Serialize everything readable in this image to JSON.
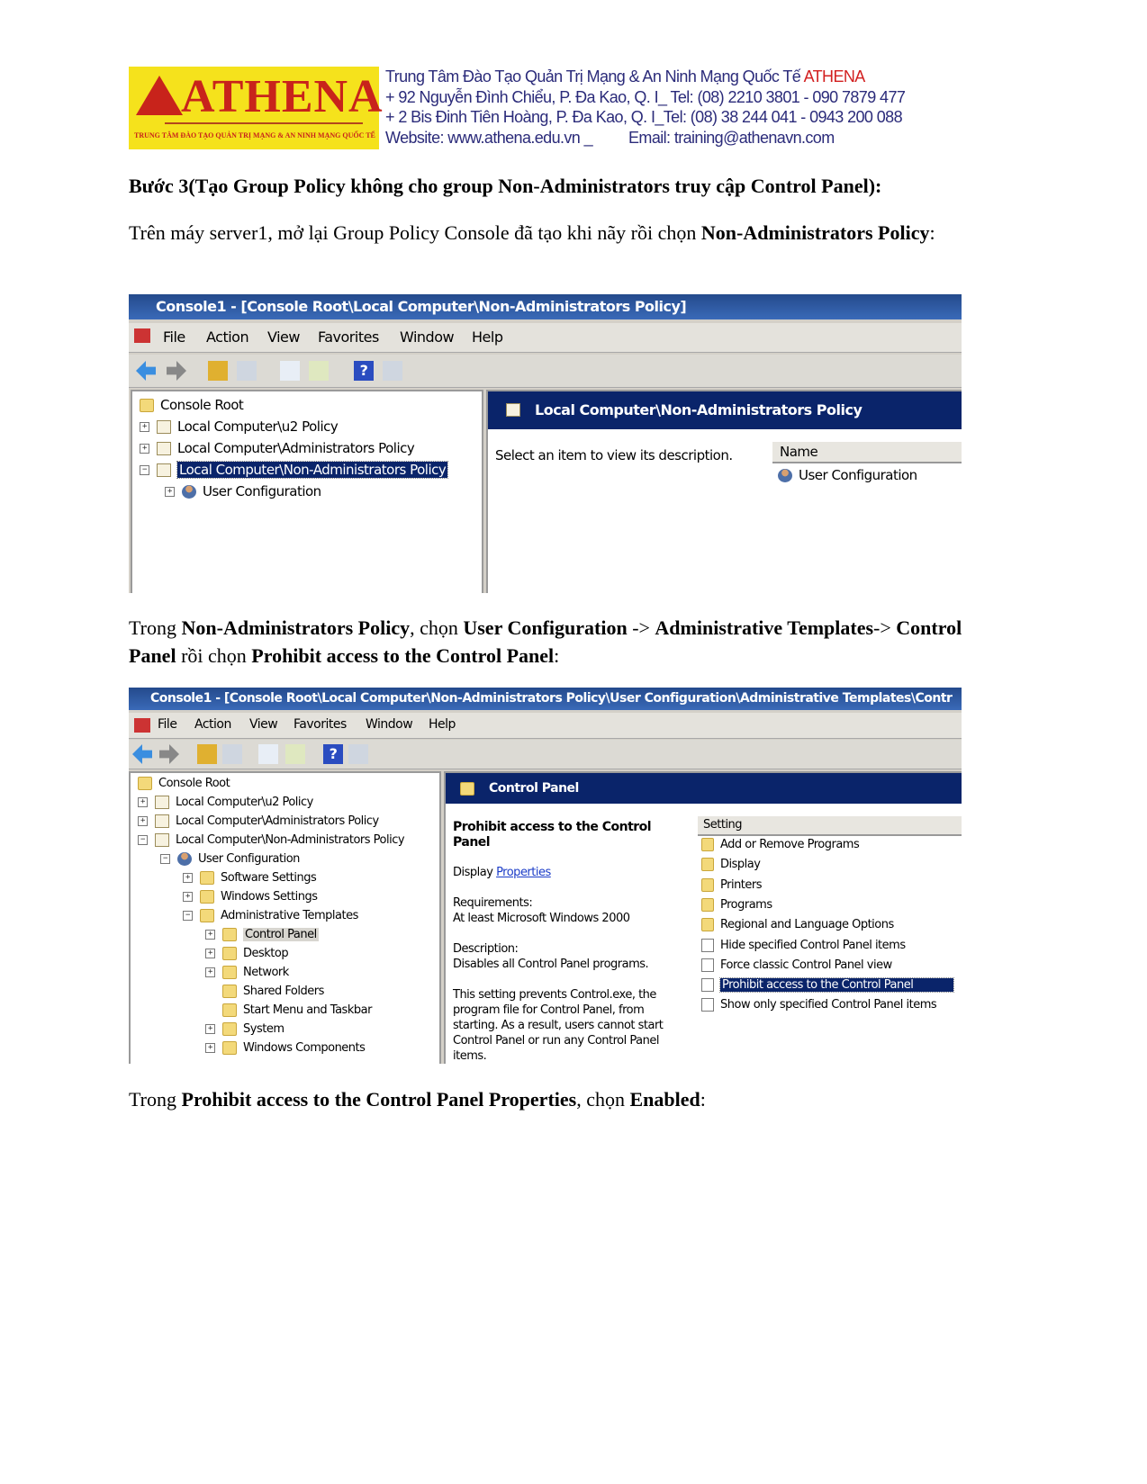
{
  "banner": {
    "logo_text": "ATHENA",
    "logo_subtitle": "TRUNG TÂM ĐÀO TẠO QUẢN TRỊ MẠNG & AN NINH MẠNG QUỐC TẾ",
    "line1": "Trung Tâm Đào Tạo Quản Trị Mạng & An Ninh Mạng Quốc Tế ",
    "brand": "ATHENA",
    "line2": "+ 92 Nguyễn Đình Chiểu, P. Đa Kao, Q. I_ Tel: (08) 2210 3801 -  090 7879 477",
    "line3": "+ 2 Bis Đinh Tiên Hoàng, P. Đa Kao, Q. I_Tel: (08) 38 244 041 - 0943 200 088",
    "website": "Website: www.athena.edu.vn   _",
    "email": "Email: training@athenavn.com",
    "colors": {
      "logo_bg": "#f5e21c",
      "logo_red": "#c8231b",
      "text_blue": "#2b2b7a"
    }
  },
  "step_heading": "Bước 3(Tạo Group Policy không cho group Non-Administrators truy cập Control Panel):",
  "para1": {
    "t1": "Trên máy server1, mở lại Group Policy Console đã tạo khi nãy rồi chọn ",
    "b1": "Non-Administrators Policy",
    "t2": ":"
  },
  "para2": {
    "t1": "Trong ",
    "b1": "Non-Administrators Policy",
    "t2": ", chọn ",
    "b2": "User Configuration",
    "t3": " -> ",
    "b3": "Administrative Templates",
    "t4": "-> ",
    "b4": "Control Panel",
    "t5": " rồi chọn ",
    "b5": "Prohibit access to the Control Panel",
    "t6": ":"
  },
  "para3": {
    "t1": "Trong ",
    "b1": "Prohibit access to the Control Panel Properties",
    "t2": ", chọn ",
    "b2": "Enabled",
    "t3": ":"
  },
  "menu": [
    "File",
    "Action",
    "View",
    "Favorites",
    "Window",
    "Help"
  ],
  "toolbar_icons": [
    "back-arrow-icon",
    "forward-arrow-icon",
    "up-folder-icon",
    "show-hide-tree-icon",
    "properties-icon",
    "export-list-icon",
    "help-icon",
    "show-action-pane-icon"
  ],
  "screenshot1": {
    "title": "Console1 - [Console Root\\Local Computer\\Non-Administrators Policy]",
    "tree": [
      {
        "label": "Console Root",
        "icon": "folder",
        "expander": "",
        "level": 0
      },
      {
        "label": "Local Computer\\u2 Policy",
        "icon": "scroll",
        "expander": "+",
        "level": 0
      },
      {
        "label": "Local Computer\\Administrators Policy",
        "icon": "scroll",
        "expander": "+",
        "level": 0
      },
      {
        "label": "Local Computer\\Non-Administrators Policy",
        "icon": "scroll",
        "expander": "−",
        "level": 0,
        "selected": true
      },
      {
        "label": "User Configuration",
        "icon": "user",
        "expander": "+",
        "level": 1
      }
    ],
    "header": "Local Computer\\Non-Administrators Policy",
    "description": "Select an item to view its description.",
    "column": "Name",
    "items": [
      "User Configuration"
    ]
  },
  "screenshot2": {
    "title": "Console1 - [Console Root\\Local Computer\\Non-Administrators Policy\\User Configuration\\Administrative Templates\\Contr",
    "tree": [
      {
        "label": "Console Root",
        "icon": "folder",
        "expander": "",
        "level": 0
      },
      {
        "label": "Local Computer\\u2 Policy",
        "icon": "scroll",
        "expander": "+",
        "level": 0
      },
      {
        "label": "Local Computer\\Administrators Policy",
        "icon": "scroll",
        "expander": "+",
        "level": 0
      },
      {
        "label": "Local Computer\\Non-Administrators Policy",
        "icon": "scroll",
        "expander": "−",
        "level": 0
      },
      {
        "label": "User Configuration",
        "icon": "user",
        "expander": "−",
        "level": 1
      },
      {
        "label": "Software Settings",
        "icon": "folder",
        "expander": "+",
        "level": 2
      },
      {
        "label": "Windows Settings",
        "icon": "folder",
        "expander": "+",
        "level": 2
      },
      {
        "label": "Administrative Templates",
        "icon": "folder",
        "expander": "−",
        "level": 2
      },
      {
        "label": "Control Panel",
        "icon": "folder",
        "expander": "+",
        "level": 3,
        "highlighted": true
      },
      {
        "label": "Desktop",
        "icon": "folder",
        "expander": "+",
        "level": 3
      },
      {
        "label": "Network",
        "icon": "folder",
        "expander": "+",
        "level": 3
      },
      {
        "label": "Shared Folders",
        "icon": "folder",
        "expander": "",
        "level": 3
      },
      {
        "label": "Start Menu and Taskbar",
        "icon": "folder",
        "expander": "",
        "level": 3
      },
      {
        "label": "System",
        "icon": "folder",
        "expander": "+",
        "level": 3
      },
      {
        "label": "Windows Components",
        "icon": "folder",
        "expander": "+",
        "level": 3
      }
    ],
    "header": "Control Panel",
    "detail_title": "Prohibit access to the Control Panel",
    "display_label": "Display ",
    "display_link": "Properties",
    "requirements_label": "Requirements:",
    "requirements_value": "At least Microsoft Windows 2000",
    "description_label": "Description:",
    "description_value": "Disables all Control Panel programs.",
    "description_more": "This setting prevents Control.exe, the program file for Control Panel, from starting. As a result, users cannot start Control Panel or run any Control Panel items.",
    "column": "Setting",
    "items": [
      {
        "label": "Add or Remove Programs",
        "icon": "folder"
      },
      {
        "label": "Display",
        "icon": "folder"
      },
      {
        "label": "Printers",
        "icon": "folder"
      },
      {
        "label": "Programs",
        "icon": "folder"
      },
      {
        "label": "Regional and Language Options",
        "icon": "folder"
      },
      {
        "label": "Hide specified Control Panel items",
        "icon": "doc"
      },
      {
        "label": "Force classic Control Panel view",
        "icon": "doc"
      },
      {
        "label": "Prohibit access to the Control Panel",
        "icon": "doc",
        "selected": true
      },
      {
        "label": "Show only specified Control Panel items",
        "icon": "doc"
      }
    ]
  }
}
